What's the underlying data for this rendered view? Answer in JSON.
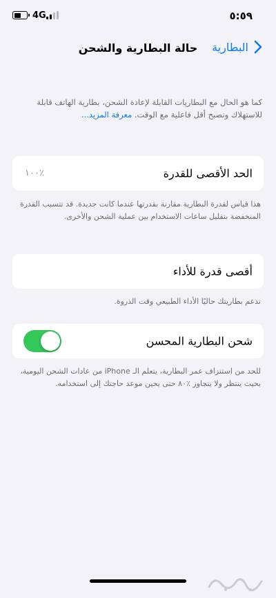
{
  "status_bar": {
    "time": "٥:٥٩",
    "network": "4G",
    "icons": [
      "battery-icon",
      "signal-icon"
    ]
  },
  "nav": {
    "back_label": "البطارية",
    "title": "حالة البطارية والشحن",
    "back_icon": "chevron-left-icon"
  },
  "intro": {
    "text": "كما هو الحال مع البطاريات القابلة لإعادة الشحن، بطارية الهاتف قابلة للاستهلاك وتصبح أقل فاعلية مع الوقت.",
    "link": "معرفة المزيد..."
  },
  "max_capacity": {
    "title": "الحد الأقصى للقدرة",
    "value": "٪١٠٠",
    "footnote": "هذا قياس لقدرة البطارية مقارنة بقدرتها عندما كانت جديدة. قد تتسبب القدرة المنخفضة بتقليل ساعات الاستخدام بين عملية الشحن والأخرى."
  },
  "peak_performance": {
    "title": "أقصى قدرة للأداء",
    "footnote": "تدعم بطاريتك حاليًا الأداء الطبيعي وقت الذروة."
  },
  "optimized_charging": {
    "title": "شحن البطارية المحسن",
    "enabled": true,
    "footnote": "للحد من استنزاف عمر البطارية، يتعلم الـ iPhone من عادات الشحن اليومية، بحيث ينتظر ولا يتجاوز ٪٨٠ حتى يحين موعد حاجتك إلى استخدامه."
  },
  "colors": {
    "accent": "#0a7aff",
    "toggle_on": "#34c759",
    "background": "#f2f2f7"
  }
}
